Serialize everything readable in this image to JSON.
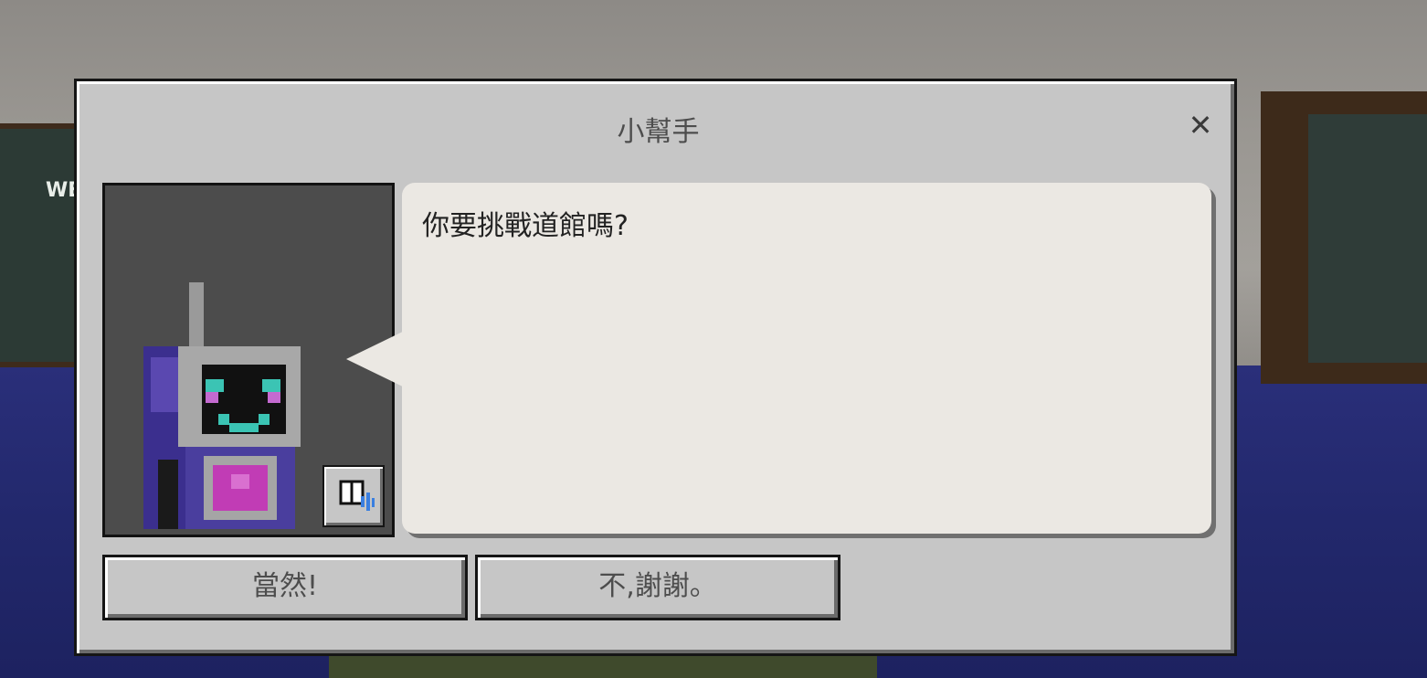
{
  "dialog": {
    "title": "小幫手",
    "close_symbol": "✕",
    "message": "你要挑戰道館嗎?",
    "buttons": {
      "accept": "當然!",
      "decline": "不,謝謝。"
    },
    "portrait": {
      "icon": "robot-npc-icon",
      "audio_button_icon": "book-audio-icon"
    }
  },
  "background": {
    "board_text": "WE"
  }
}
